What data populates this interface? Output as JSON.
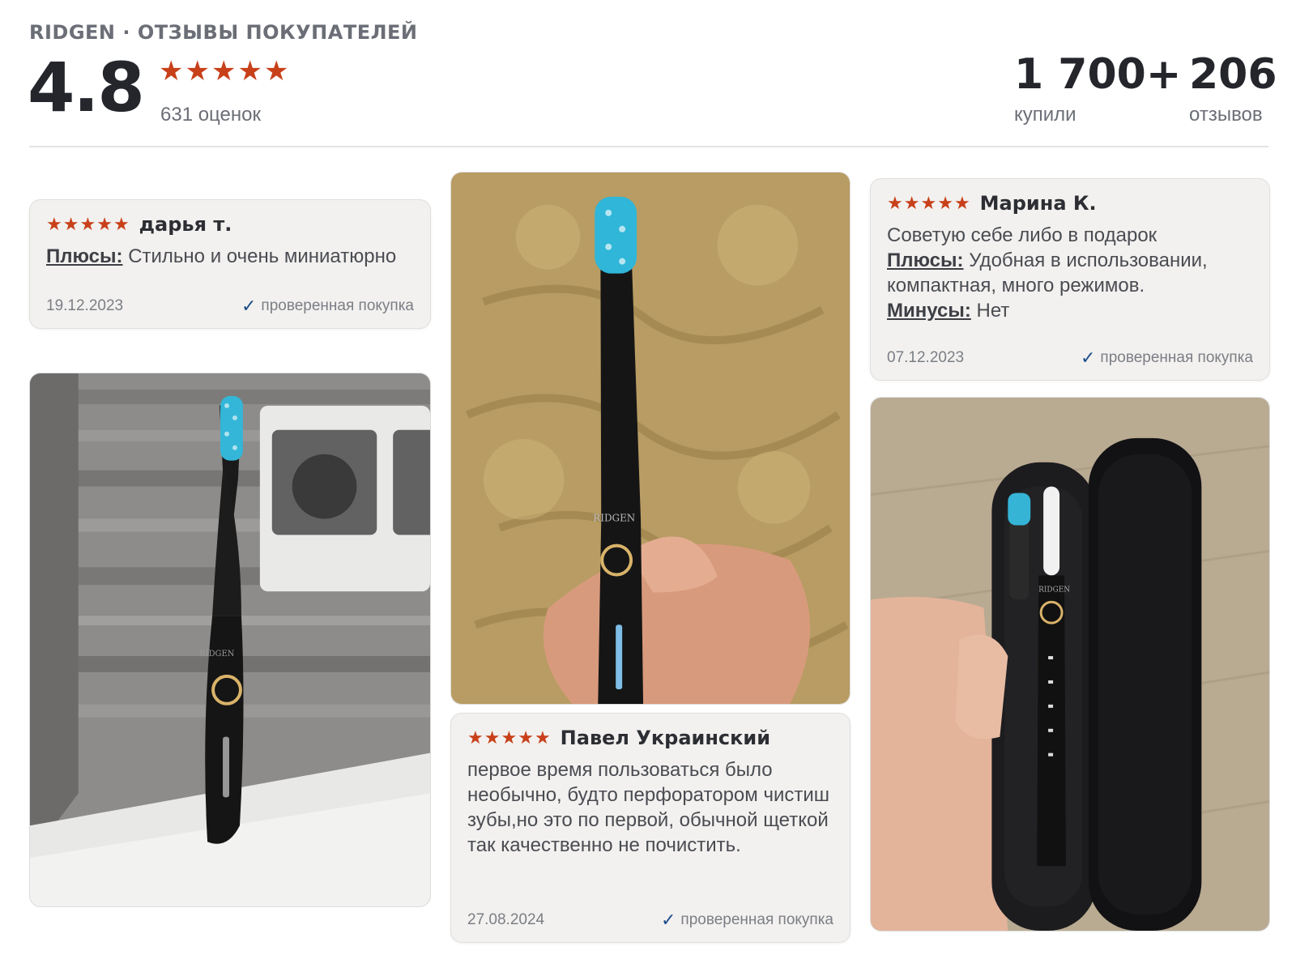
{
  "header": {
    "brand_title": "RIDGEN · ОТЗЫВЫ ПОКУПАТЕЛЕЙ",
    "rating": "4.8",
    "rating_stars": 5,
    "ratings_count": "631 оценок",
    "bought_value": "1 700+",
    "bought_label": "купили",
    "reviews_value": "206",
    "reviews_label": "отзывов"
  },
  "reviews": [
    {
      "author": "дарья т.",
      "stars": 5,
      "pros_label": "Плюсы:",
      "pros": "Стильно и очень миниатюрно",
      "date": "19.12.2023",
      "verified": "проверенная покупка"
    },
    {
      "author": "Марина К.",
      "stars": 5,
      "comment": "Советую себе либо в подарок",
      "pros_label": "Плюсы:",
      "pros": "Удобная в использовании, компактная, много режимов.",
      "cons_label": "Минусы:",
      "cons": "Нет",
      "date": "07.12.2023",
      "verified": "проверенная покупка"
    },
    {
      "author": "Павел Украинский",
      "stars": 5,
      "comment": "первое время пользоваться было необычно, будто перфоратором чистиш зубы,но это по первой, обычной щеткой так качественно не почистить.",
      "date": "27.08.2024",
      "verified": "проверенная покупка"
    }
  ],
  "photos": {
    "brand_mark": "RIDGEN"
  },
  "colors": {
    "star": "#c8401a",
    "check": "#1f4e8c",
    "card_bg": "#f2f1ef",
    "heading": "#24262c",
    "muted": "#6b6e76"
  }
}
